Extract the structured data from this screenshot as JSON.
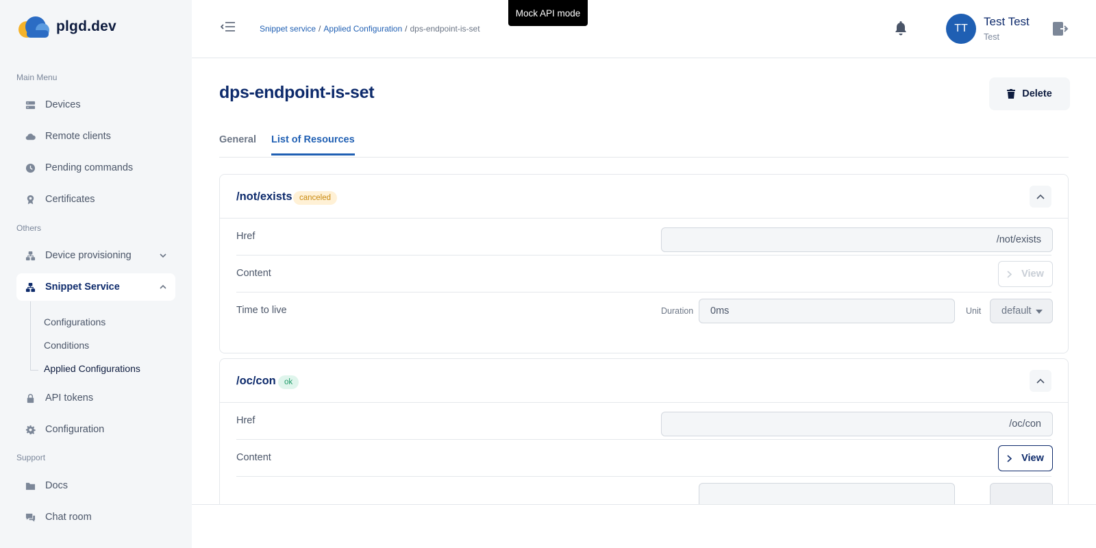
{
  "app": {
    "name": "plgd.dev"
  },
  "sidebar": {
    "sections": {
      "main": "Main Menu",
      "others": "Others",
      "support": "Support"
    },
    "items": {
      "devices": {
        "label": "Devices",
        "icon": "devices-icon"
      },
      "remote_clients": {
        "label": "Remote clients",
        "icon": "cloud-icon"
      },
      "pending_commands": {
        "label": "Pending commands",
        "icon": "clock-icon"
      },
      "certificates": {
        "label": "Certificates",
        "icon": "certificate-icon"
      },
      "device_provisioning": {
        "label": "Device provisioning",
        "icon": "network-icon"
      },
      "snippet_service": {
        "label": "Snippet Service",
        "icon": "network-icon"
      },
      "api_tokens": {
        "label": "API tokens",
        "icon": "lock-icon"
      },
      "configuration": {
        "label": "Configuration",
        "icon": "gear-icon"
      },
      "docs": {
        "label": "Docs",
        "icon": "folder-icon"
      },
      "chat_room": {
        "label": "Chat room",
        "icon": "chat-icon"
      }
    },
    "snippet_sub": {
      "configurations": "Configurations",
      "conditions": "Conditions",
      "applied_configurations": "Applied Configurations"
    }
  },
  "header": {
    "breadcrumb": {
      "first": "Snippet service",
      "second": "Applied Configuration",
      "current": "dps-endpoint-is-set",
      "separator": "/"
    },
    "mock_badge": "Mock API mode",
    "user": {
      "initials": "TT",
      "name": "Test Test",
      "role": "Test"
    }
  },
  "page": {
    "title": "dps-endpoint-is-set",
    "delete_label": "Delete",
    "tabs": {
      "general": "General",
      "resources": "List of Resources"
    }
  },
  "resources": [
    {
      "title": "/not/exists",
      "status": "canceled",
      "href_label": "Href",
      "href_value": "/not/exists",
      "content_label": "Content",
      "view_label": "View",
      "ttl_label": "Time to live",
      "duration_label": "Duration",
      "duration_value": "0ms",
      "unit_label": "Unit",
      "unit_value": "default"
    },
    {
      "title": "/oc/con",
      "status": "ok",
      "href_label": "Href",
      "href_value": "/oc/con",
      "content_label": "Content",
      "view_label": "View"
    }
  ],
  "colors": {
    "accent": "#1f5fb3",
    "title": "#0d2a6b",
    "status_canceled": "#c98a10",
    "status_ok": "#1f9b68"
  }
}
